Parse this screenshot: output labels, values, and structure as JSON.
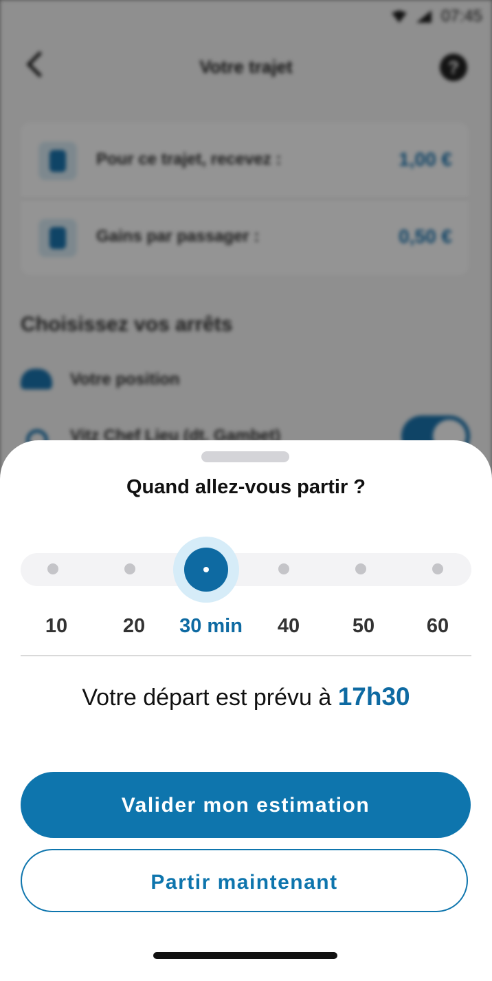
{
  "status_bar": {
    "time": "07:45",
    "wifi_icon": "wifi-icon",
    "signal_icon": "signal-icon"
  },
  "header": {
    "title": "Votre trajet",
    "back_icon": "chevron-left-icon",
    "help_icon": "help-icon",
    "help_glyph": "?"
  },
  "earnings": [
    {
      "label": "Pour ce trajet, recevez :",
      "value": "1,00 €"
    },
    {
      "label": "Gains par passager :",
      "value": "0,50 €"
    }
  ],
  "stops": {
    "title": "Choisissez vos arrêts",
    "items": [
      {
        "label": "Votre position"
      },
      {
        "label": "Vitz Chef Lieu (dt. Gambet)",
        "enabled": true
      }
    ]
  },
  "sheet": {
    "title": "Quand allez-vous partir ?",
    "slider": {
      "options": [
        "10",
        "20",
        "30 min",
        "40",
        "50",
        "60"
      ],
      "selected_index": 2,
      "selected_value_minutes": 30
    },
    "departure": {
      "text": "Votre départ est prévu à",
      "time": "17h30"
    },
    "primary_button": "Valider mon estimation",
    "secondary_button": "Partir maintenant"
  },
  "colors": {
    "accent": "#0e75ad",
    "accent_dark": "#0e6aa2",
    "halo": "#d6ecf8",
    "track": "#f3f3f5"
  }
}
